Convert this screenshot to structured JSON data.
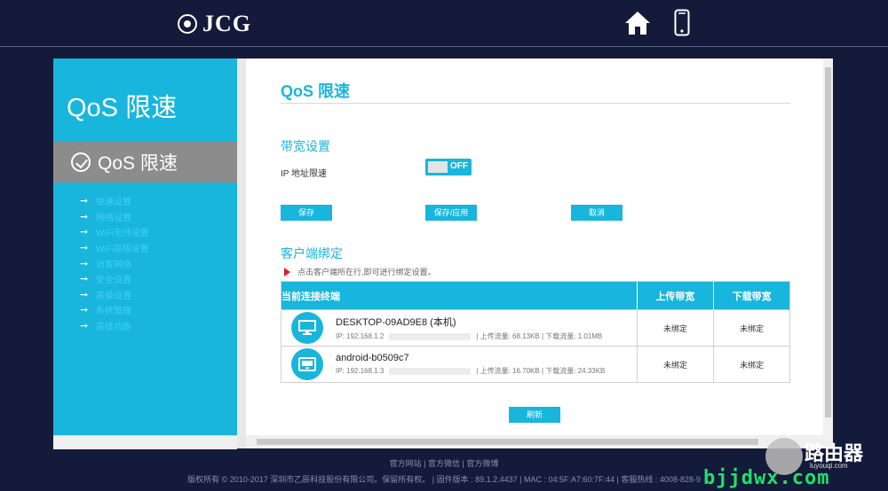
{
  "header": {
    "logo_text": "JCG",
    "home_icon": "home-icon",
    "mobile_icon": "mobile-phone-icon"
  },
  "sidebar": {
    "title": "QoS 限速",
    "active_item": "QoS 限速",
    "items": [
      {
        "label": "快速设置"
      },
      {
        "label": "网络设置"
      },
      {
        "label": "WiFi无线设置"
      },
      {
        "label": "WiFi高级设置"
      },
      {
        "label": "访客网络"
      },
      {
        "label": "安全设置"
      },
      {
        "label": "高级设置"
      },
      {
        "label": "系统管理"
      },
      {
        "label": "高级功能"
      }
    ]
  },
  "main": {
    "page_title": "QoS 限速",
    "bandwidth_section_title": "带宽设置",
    "ip_limit_label": "IP 地址限速",
    "toggle_state": "OFF",
    "buttons": {
      "save": "保存",
      "save_apply": "保存/应用",
      "cancel": "取消",
      "refresh": "刷新"
    },
    "client_section_title": "客户端绑定",
    "client_hint": "点击客户端所在行,即可进行绑定设置。",
    "table": {
      "headers": [
        "当前连接终端",
        "上传带宽",
        "下载带宽"
      ],
      "rows": [
        {
          "device": "DESKTOP-09AD9E8 (本机)",
          "ip": "IP: 192.168.1.2",
          "upload_traffic": "上传流量: 68.13KB",
          "download_traffic": "下载流量: 1.01MB",
          "upload_bw": "未绑定",
          "download_bw": "未绑定"
        },
        {
          "device": "android-b0509c7",
          "ip": "IP: 192.168.1.3",
          "upload_traffic": "上传流量: 16.70KB",
          "download_traffic": "下载流量: 24.33KB",
          "upload_bw": "未绑定",
          "download_bw": "未绑定"
        }
      ]
    }
  },
  "footer": {
    "links": [
      "官方网站",
      "官方微信",
      "官方微博"
    ],
    "copyright": "版权所有 © 2010-2017 深圳市乙辰科技股份有限公司。保留所有权。 | 固件版本 : 89.1.2.4437 | MAC : 04:5F:A7:60:7F:44 | 客服热线 : 4008-828-9"
  },
  "watermark": {
    "text1": "路由器",
    "text2": "luyouqi.com",
    "text3": "bjjdwx.com"
  },
  "colors": {
    "accent": "#18b5dc",
    "background": "#141a3a",
    "active_menu": "#8c8c8c"
  }
}
